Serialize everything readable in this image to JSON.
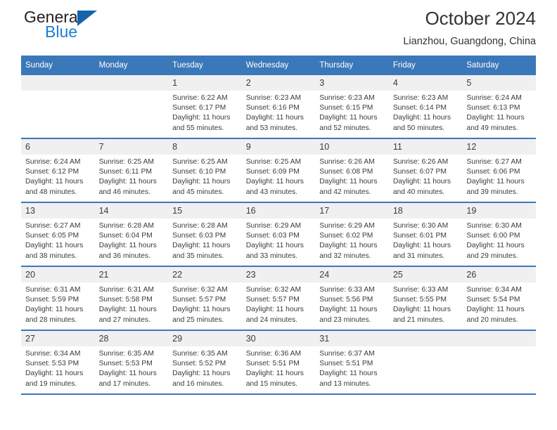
{
  "brand": {
    "line1": "General",
    "line2": "Blue"
  },
  "header": {
    "title": "October 2024",
    "subtitle": "Lianzhou, Guangdong, China"
  },
  "colors": {
    "header_blue": "#3b78b9",
    "brand_blue": "#1a7fd4",
    "daystrip_gray": "#f0f0f0"
  },
  "weekday_headers": [
    "Sunday",
    "Monday",
    "Tuesday",
    "Wednesday",
    "Thursday",
    "Friday",
    "Saturday"
  ],
  "weeks": [
    [
      {
        "day": "",
        "empty": true
      },
      {
        "day": "",
        "empty": true
      },
      {
        "day": "1",
        "sunrise": "Sunrise: 6:22 AM",
        "sunset": "Sunset: 6:17 PM",
        "daylight1": "Daylight: 11 hours",
        "daylight2": "and 55 minutes."
      },
      {
        "day": "2",
        "sunrise": "Sunrise: 6:23 AM",
        "sunset": "Sunset: 6:16 PM",
        "daylight1": "Daylight: 11 hours",
        "daylight2": "and 53 minutes."
      },
      {
        "day": "3",
        "sunrise": "Sunrise: 6:23 AM",
        "sunset": "Sunset: 6:15 PM",
        "daylight1": "Daylight: 11 hours",
        "daylight2": "and 52 minutes."
      },
      {
        "day": "4",
        "sunrise": "Sunrise: 6:23 AM",
        "sunset": "Sunset: 6:14 PM",
        "daylight1": "Daylight: 11 hours",
        "daylight2": "and 50 minutes."
      },
      {
        "day": "5",
        "sunrise": "Sunrise: 6:24 AM",
        "sunset": "Sunset: 6:13 PM",
        "daylight1": "Daylight: 11 hours",
        "daylight2": "and 49 minutes."
      }
    ],
    [
      {
        "day": "6",
        "sunrise": "Sunrise: 6:24 AM",
        "sunset": "Sunset: 6:12 PM",
        "daylight1": "Daylight: 11 hours",
        "daylight2": "and 48 minutes."
      },
      {
        "day": "7",
        "sunrise": "Sunrise: 6:25 AM",
        "sunset": "Sunset: 6:11 PM",
        "daylight1": "Daylight: 11 hours",
        "daylight2": "and 46 minutes."
      },
      {
        "day": "8",
        "sunrise": "Sunrise: 6:25 AM",
        "sunset": "Sunset: 6:10 PM",
        "daylight1": "Daylight: 11 hours",
        "daylight2": "and 45 minutes."
      },
      {
        "day": "9",
        "sunrise": "Sunrise: 6:25 AM",
        "sunset": "Sunset: 6:09 PM",
        "daylight1": "Daylight: 11 hours",
        "daylight2": "and 43 minutes."
      },
      {
        "day": "10",
        "sunrise": "Sunrise: 6:26 AM",
        "sunset": "Sunset: 6:08 PM",
        "daylight1": "Daylight: 11 hours",
        "daylight2": "and 42 minutes."
      },
      {
        "day": "11",
        "sunrise": "Sunrise: 6:26 AM",
        "sunset": "Sunset: 6:07 PM",
        "daylight1": "Daylight: 11 hours",
        "daylight2": "and 40 minutes."
      },
      {
        "day": "12",
        "sunrise": "Sunrise: 6:27 AM",
        "sunset": "Sunset: 6:06 PM",
        "daylight1": "Daylight: 11 hours",
        "daylight2": "and 39 minutes."
      }
    ],
    [
      {
        "day": "13",
        "sunrise": "Sunrise: 6:27 AM",
        "sunset": "Sunset: 6:05 PM",
        "daylight1": "Daylight: 11 hours",
        "daylight2": "and 38 minutes."
      },
      {
        "day": "14",
        "sunrise": "Sunrise: 6:28 AM",
        "sunset": "Sunset: 6:04 PM",
        "daylight1": "Daylight: 11 hours",
        "daylight2": "and 36 minutes."
      },
      {
        "day": "15",
        "sunrise": "Sunrise: 6:28 AM",
        "sunset": "Sunset: 6:03 PM",
        "daylight1": "Daylight: 11 hours",
        "daylight2": "and 35 minutes."
      },
      {
        "day": "16",
        "sunrise": "Sunrise: 6:29 AM",
        "sunset": "Sunset: 6:03 PM",
        "daylight1": "Daylight: 11 hours",
        "daylight2": "and 33 minutes."
      },
      {
        "day": "17",
        "sunrise": "Sunrise: 6:29 AM",
        "sunset": "Sunset: 6:02 PM",
        "daylight1": "Daylight: 11 hours",
        "daylight2": "and 32 minutes."
      },
      {
        "day": "18",
        "sunrise": "Sunrise: 6:30 AM",
        "sunset": "Sunset: 6:01 PM",
        "daylight1": "Daylight: 11 hours",
        "daylight2": "and 31 minutes."
      },
      {
        "day": "19",
        "sunrise": "Sunrise: 6:30 AM",
        "sunset": "Sunset: 6:00 PM",
        "daylight1": "Daylight: 11 hours",
        "daylight2": "and 29 minutes."
      }
    ],
    [
      {
        "day": "20",
        "sunrise": "Sunrise: 6:31 AM",
        "sunset": "Sunset: 5:59 PM",
        "daylight1": "Daylight: 11 hours",
        "daylight2": "and 28 minutes."
      },
      {
        "day": "21",
        "sunrise": "Sunrise: 6:31 AM",
        "sunset": "Sunset: 5:58 PM",
        "daylight1": "Daylight: 11 hours",
        "daylight2": "and 27 minutes."
      },
      {
        "day": "22",
        "sunrise": "Sunrise: 6:32 AM",
        "sunset": "Sunset: 5:57 PM",
        "daylight1": "Daylight: 11 hours",
        "daylight2": "and 25 minutes."
      },
      {
        "day": "23",
        "sunrise": "Sunrise: 6:32 AM",
        "sunset": "Sunset: 5:57 PM",
        "daylight1": "Daylight: 11 hours",
        "daylight2": "and 24 minutes."
      },
      {
        "day": "24",
        "sunrise": "Sunrise: 6:33 AM",
        "sunset": "Sunset: 5:56 PM",
        "daylight1": "Daylight: 11 hours",
        "daylight2": "and 23 minutes."
      },
      {
        "day": "25",
        "sunrise": "Sunrise: 6:33 AM",
        "sunset": "Sunset: 5:55 PM",
        "daylight1": "Daylight: 11 hours",
        "daylight2": "and 21 minutes."
      },
      {
        "day": "26",
        "sunrise": "Sunrise: 6:34 AM",
        "sunset": "Sunset: 5:54 PM",
        "daylight1": "Daylight: 11 hours",
        "daylight2": "and 20 minutes."
      }
    ],
    [
      {
        "day": "27",
        "sunrise": "Sunrise: 6:34 AM",
        "sunset": "Sunset: 5:53 PM",
        "daylight1": "Daylight: 11 hours",
        "daylight2": "and 19 minutes."
      },
      {
        "day": "28",
        "sunrise": "Sunrise: 6:35 AM",
        "sunset": "Sunset: 5:53 PM",
        "daylight1": "Daylight: 11 hours",
        "daylight2": "and 17 minutes."
      },
      {
        "day": "29",
        "sunrise": "Sunrise: 6:35 AM",
        "sunset": "Sunset: 5:52 PM",
        "daylight1": "Daylight: 11 hours",
        "daylight2": "and 16 minutes."
      },
      {
        "day": "30",
        "sunrise": "Sunrise: 6:36 AM",
        "sunset": "Sunset: 5:51 PM",
        "daylight1": "Daylight: 11 hours",
        "daylight2": "and 15 minutes."
      },
      {
        "day": "31",
        "sunrise": "Sunrise: 6:37 AM",
        "sunset": "Sunset: 5:51 PM",
        "daylight1": "Daylight: 11 hours",
        "daylight2": "and 13 minutes."
      },
      {
        "day": "",
        "empty": true
      },
      {
        "day": "",
        "empty": true
      }
    ]
  ]
}
